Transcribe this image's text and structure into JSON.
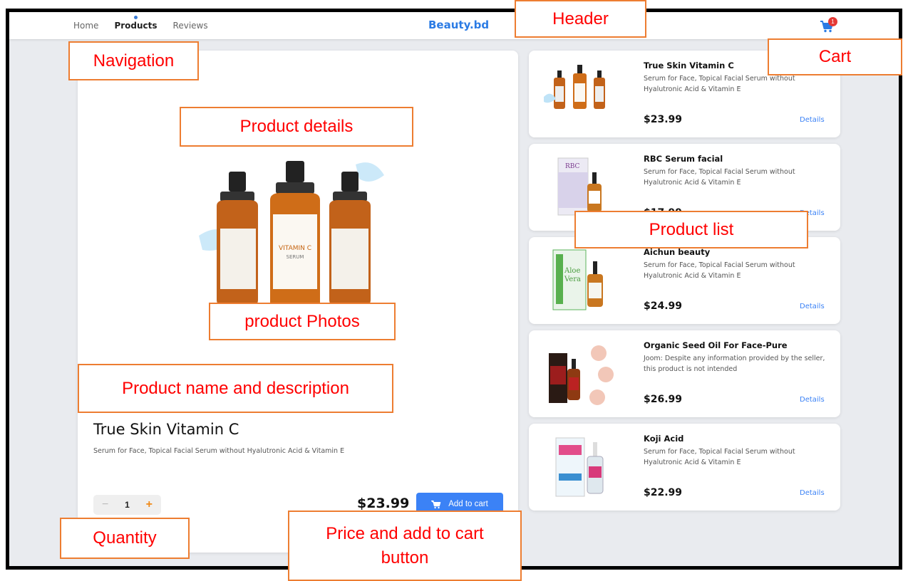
{
  "header": {
    "nav": [
      {
        "label": "Home",
        "active": false
      },
      {
        "label": "Products",
        "active": true
      },
      {
        "label": "Reviews",
        "active": false
      }
    ],
    "brand": "Beauty.bd",
    "cart": {
      "icon": "cart-icon",
      "count": "1"
    }
  },
  "detail": {
    "name": "True Skin Vitamin C",
    "description": "Serum for Face, Topical Facial Serum without Hyalutronic Acid & Vitamin E",
    "quantity": "1",
    "price": "$23.99",
    "add_to_cart_label": "Add to cart",
    "hero_bottle_label": "VITAMIN C",
    "hero_bottle_sub": "SERUM"
  },
  "products": [
    {
      "name": "True Skin Vitamin C",
      "description": "Serum for Face, Topical Facial Serum without Hyalutronic Acid & Vitamin E",
      "price": "$23.99",
      "link": "Details"
    },
    {
      "name": "RBC Serum facial",
      "description": "Serum for Face, Topical Facial Serum without Hyalutronic Acid & Vitamin E",
      "price": "$17.99",
      "link": "Details"
    },
    {
      "name": "Aichun beauty",
      "description": "Serum for Face, Topical Facial Serum without Hyalutronic Acid & Vitamin E",
      "price": "$24.99",
      "link": "Details"
    },
    {
      "name": "Organic Seed Oil For Face-Pure",
      "description": "Joom: Despite any information provided by the seller, this product is not intended",
      "price": "$26.99",
      "link": "Details"
    },
    {
      "name": "Koji Acid",
      "description": "Serum for Face, Topical Facial Serum without Hyalutronic Acid & Vitamin E",
      "price": "$22.99",
      "link": "Details"
    }
  ],
  "annotations": {
    "header": "Header",
    "navigation": "Navigation",
    "cart": "Cart",
    "product_details": "Product details",
    "product_list": "Product list",
    "product_photos": "product Photos",
    "name_desc": "Product name and description",
    "quantity": "Quantity",
    "price_cart": "Price and add to cart button"
  },
  "colors": {
    "accent": "#3b82f6",
    "brand": "#2b7be4",
    "annotation_border": "#ed7d31",
    "annotation_text": "#ff0000"
  }
}
